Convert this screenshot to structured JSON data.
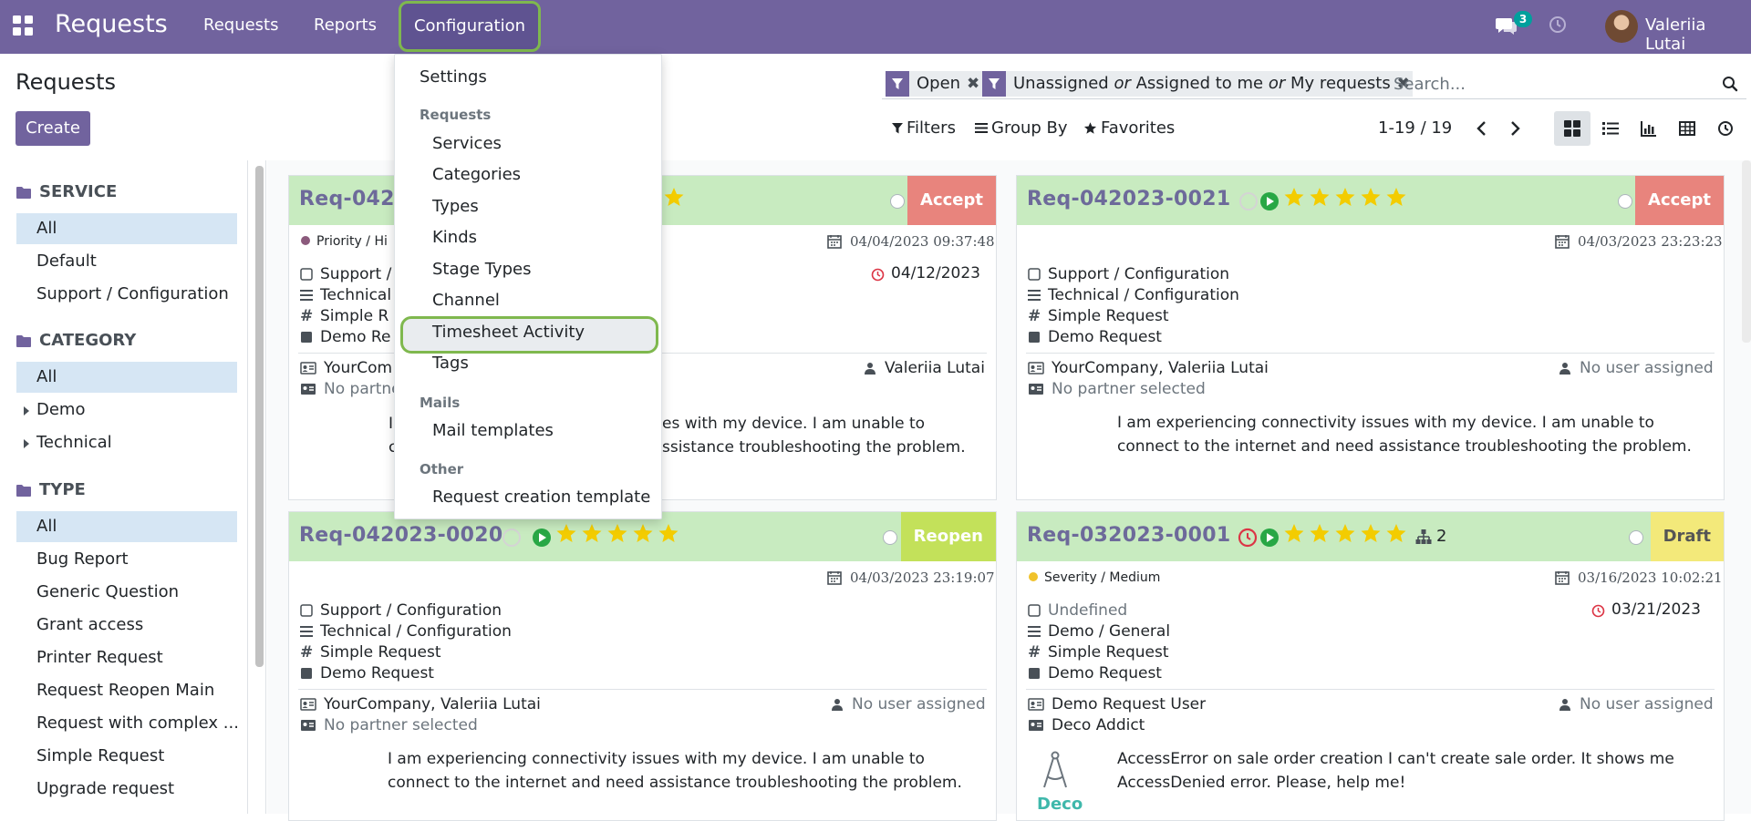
{
  "navbar": {
    "brand": "Requests",
    "menu": [
      "Requests",
      "Reports",
      "Configuration"
    ],
    "chat_count": "3",
    "user_name": "Valeriia Lutai"
  },
  "control_panel": {
    "title": "Requests",
    "create_label": "Create",
    "facets": [
      "Open",
      "Unassigned or Assigned to me or My requests"
    ],
    "facet2_parts": [
      "Unassigned",
      "or",
      "Assigned to me",
      "or",
      "My requests"
    ],
    "search_placeholder": "Search...",
    "filters_label": "Filters",
    "groupby_label": "Group By",
    "favorites_label": "Favorites",
    "pager": "1-19 / 19",
    "views": [
      "kanban-view",
      "list-view",
      "graph-view",
      "pivot-view",
      "activity-view"
    ]
  },
  "dropdown": {
    "settings": "Settings",
    "group_requests": "Requests",
    "requests_items": [
      "Services",
      "Categories",
      "Types",
      "Kinds",
      "Stage Types",
      "Channel",
      "Timesheet Activity",
      "Tags"
    ],
    "group_mails": "Mails",
    "mail_items": [
      "Mail templates"
    ],
    "group_other": "Other",
    "other_items": [
      "Request creation template"
    ]
  },
  "sidebar": {
    "service_head": "SERVICE",
    "service_items": [
      "All",
      "Default",
      "Support / Configuration"
    ],
    "category_head": "CATEGORY",
    "category_items": [
      "All",
      "Demo",
      "Technical"
    ],
    "type_head": "TYPE",
    "type_items": [
      "All",
      "Bug Report",
      "Generic Question",
      "Grant access",
      "Printer Request",
      "Request Reopen Main",
      "Request with complex ...",
      "Simple Request",
      "Upgrade request"
    ]
  },
  "cards": [
    {
      "title": "Req-042",
      "stage": "Accept",
      "stage_color": "#e8847d",
      "priority": "Priority / Hi",
      "date": "04/04/2023 09:37:48",
      "deadline": "04/12/2023",
      "service": "Support /",
      "category": "Technical",
      "type": "Simple R",
      "kind": "Demo Re",
      "author": "YourCom",
      "assignee": "Valeriia Lutai",
      "partner": "No partne",
      "desc_1": "I",
      "desc_1b": "es with my device. I am unable to",
      "desc_2": "c",
      "desc_2b": "ssistance troubleshooting the problem."
    },
    {
      "title": "Req-042023-0021",
      "stage": "Accept",
      "stage_color": "#e8847d",
      "date": "04/03/2023 23:23:23",
      "service": "Support / Configuration",
      "category": "Technical / Configuration",
      "type": "Simple Request",
      "kind": "Demo Request",
      "author": "YourCompany, Valeriia Lutai",
      "assignee": "No user assigned",
      "partner": "No partner selected",
      "desc": "I am experiencing connectivity issues with my device. I am unable to connect to the internet and need assistance troubleshooting the problem."
    },
    {
      "title": "Req-042023-0020",
      "stage": "Reopen",
      "stage_color": "#c3e15a",
      "date": "04/03/2023 23:19:07",
      "service": "Support / Configuration",
      "category": "Technical / Configuration",
      "type": "Simple Request",
      "kind": "Demo Request",
      "author": "YourCompany, Valeriia Lutai",
      "assignee": "No user assigned",
      "partner": "No partner selected",
      "desc": "I am experiencing connectivity issues with my device. I am unable to connect to the internet and need assistance troubleshooting the problem."
    },
    {
      "title": "Req-032023-0001",
      "stage": "Draft",
      "stage_color": "#f3e97a",
      "subtasks": "2",
      "priority": "Severity / Medium",
      "date": "03/16/2023 10:02:21",
      "deadline": "03/21/2023",
      "service": "Undefined",
      "category": "Demo / General",
      "type": "Simple Request",
      "kind": "Demo Request",
      "author": "Demo Request User",
      "assignee": "No user assigned",
      "partner": "Deco Addict",
      "logo_text": "Deco",
      "desc": "AccessError on sale order creation I can't create sale order. It shows me AccessDenied error. Please, help me!"
    }
  ],
  "colors": {
    "brand": "#71639e",
    "card_header": "#c8ebc0",
    "highlight": "#7fb84e",
    "star": "#f3cc00"
  }
}
